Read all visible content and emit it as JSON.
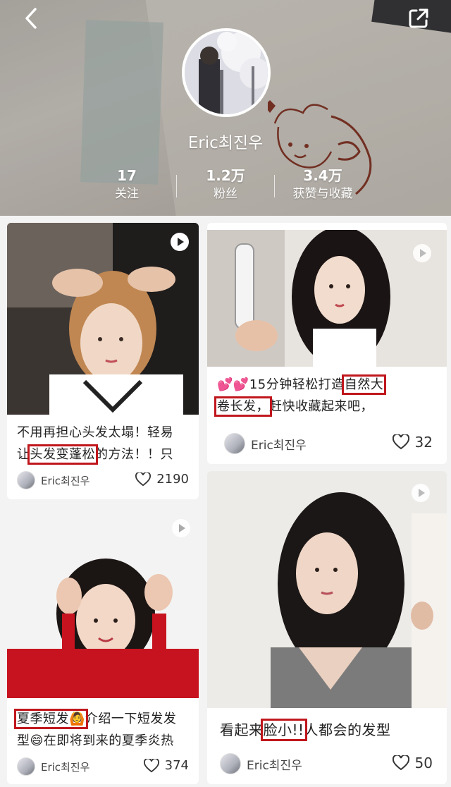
{
  "profile": {
    "name": "Eric최진우",
    "stats": [
      {
        "value": "17",
        "label": "关注"
      },
      {
        "value": "1.2万",
        "label": "粉丝"
      },
      {
        "value": "3.4万",
        "label": "获赞与收藏"
      }
    ]
  },
  "icons": {
    "back": "chevron-left-icon",
    "share": "share-icon",
    "play": "play-icon",
    "like": "heart-icon"
  },
  "colors": {
    "highlight": "#c0171d"
  },
  "feed": [
    {
      "title_parts": [
        "不用再担心头发太塌！轻易",
        "让",
        "头发变蓬松",
        "的方法！！只"
      ],
      "author": "Eric최진우",
      "likes": "2190"
    },
    {
      "title_parts": [
        "💕💕15分钟轻松打造",
        "自然大",
        "卷长发，",
        "赶快收藏起来吧，"
      ],
      "author": "Eric최진우",
      "likes": "32"
    },
    {
      "title_parts": [
        "夏季短发🙆",
        "介绍一下短发发",
        "型😄在即将到来的夏季炎热"
      ],
      "author": "Eric최진우",
      "likes": "374"
    },
    {
      "title_parts": [
        "看起来",
        "脸小!!",
        "人都会的发型"
      ],
      "author": "Eric최진우",
      "likes": "50"
    }
  ]
}
